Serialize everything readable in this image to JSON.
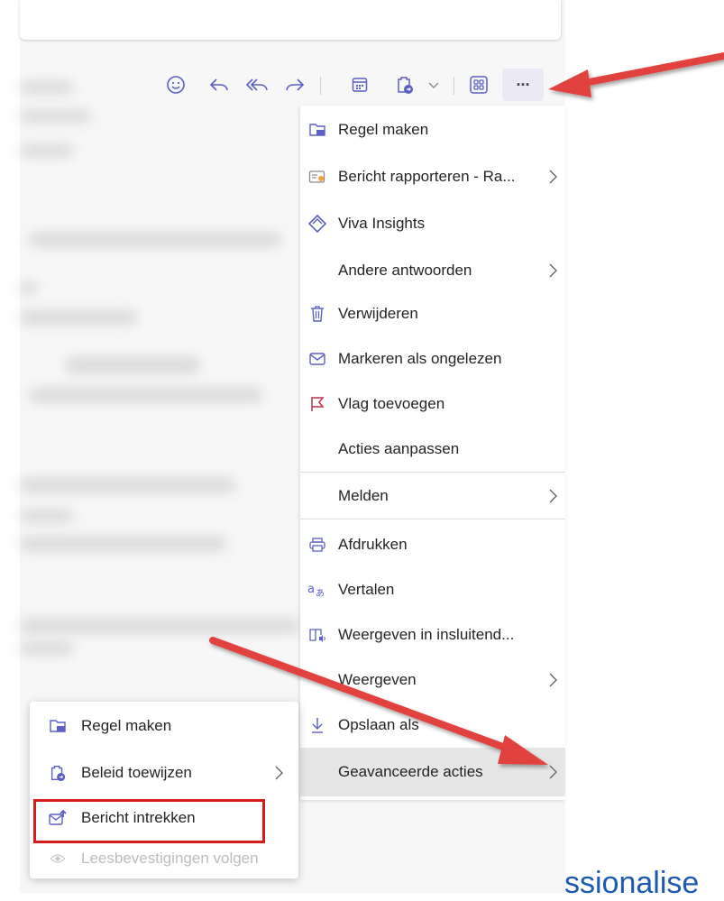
{
  "toolbar": {
    "buttons": [
      {
        "name": "emoji-icon",
        "tooltip": "React"
      },
      {
        "name": "reply-icon",
        "tooltip": "Reply"
      },
      {
        "name": "reply-all-icon",
        "tooltip": "Reply all"
      },
      {
        "name": "forward-icon",
        "tooltip": "Forward"
      },
      {
        "name": "calendar-icon",
        "tooltip": "Calendar"
      },
      {
        "name": "policy-icon",
        "tooltip": "Policy"
      },
      {
        "name": "apps-icon",
        "tooltip": "Apps"
      },
      {
        "name": "more-icon",
        "tooltip": "More actions"
      }
    ],
    "more_label": "···"
  },
  "menu": {
    "items": [
      {
        "label": "Regel maken",
        "icon": "rule-icon",
        "has_submenu": false
      },
      {
        "label": "Bericht rapporteren - Ra...",
        "icon": "report-message-icon",
        "has_submenu": true
      },
      {
        "label": "Viva Insights",
        "icon": "viva-insights-icon",
        "has_submenu": false
      },
      {
        "label": "Andere antwoorden",
        "icon": "",
        "has_submenu": true
      },
      {
        "label": "Verwijderen",
        "icon": "trash-icon",
        "has_submenu": false
      },
      {
        "label": "Markeren als ongelezen",
        "icon": "envelope-icon",
        "has_submenu": false
      },
      {
        "label": "Vlag toevoegen",
        "icon": "flag-icon",
        "has_submenu": false
      },
      {
        "label": "Acties aanpassen",
        "icon": "",
        "has_submenu": false
      },
      {
        "label": "Melden",
        "icon": "",
        "has_submenu": true
      },
      {
        "label": "Afdrukken",
        "icon": "printer-icon",
        "has_submenu": false
      },
      {
        "label": "Vertalen",
        "icon": "translate-icon",
        "has_submenu": false
      },
      {
        "label": "Weergeven in insluitend...",
        "icon": "immersive-reader-icon",
        "has_submenu": false
      },
      {
        "label": "Weergeven",
        "icon": "",
        "has_submenu": true
      },
      {
        "label": "Opslaan als",
        "icon": "download-icon",
        "has_submenu": false
      },
      {
        "label": "Geavanceerde acties",
        "icon": "",
        "has_submenu": true,
        "highlighted": true
      }
    ]
  },
  "submenu": {
    "items": [
      {
        "label": "Regel maken",
        "icon": "rule-icon",
        "disabled": false
      },
      {
        "label": "Beleid toewijzen",
        "icon": "policy-icon",
        "disabled": false,
        "has_submenu": true
      },
      {
        "label": "Bericht intrekken",
        "icon": "recall-icon",
        "disabled": false,
        "outlined": true
      },
      {
        "label": "Leesbevestigingen volgen",
        "icon": "eye-icon",
        "disabled": true
      }
    ]
  },
  "watermark_text": "ssionalise",
  "colors": {
    "accent": "#5b5fc7",
    "annotation_red": "#e2423e",
    "highlight_box": "#d71b1b",
    "flag_red": "#c4314b",
    "watermark_blue": "#1d5bb0"
  }
}
